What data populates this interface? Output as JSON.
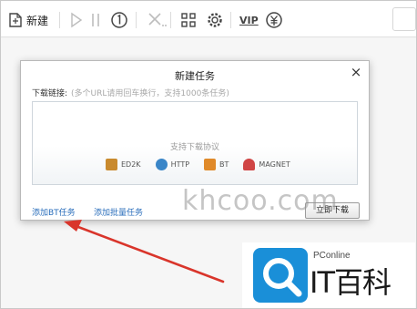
{
  "toolbar": {
    "new_label": "新建",
    "vip_label": "VIP",
    "icons": [
      "new-task-icon",
      "start-icon",
      "pause-icon",
      "info-icon",
      "delete-icon",
      "apps-icon",
      "settings-icon",
      "vip-icon",
      "coin-icon",
      "search-icon"
    ]
  },
  "dialog": {
    "title": "新建任务",
    "close": "×",
    "link_label": "下载链接:",
    "link_hint": "(多个URL请用回车换行，支持1000条任务)",
    "protocols_title": "支持下载协议",
    "protocols": [
      {
        "name": "ED2K",
        "color": "#c98a2e"
      },
      {
        "name": "HTTP",
        "color": "#3a86c8"
      },
      {
        "name": "BT",
        "color": "#e08a2a"
      },
      {
        "name": "MAGNET",
        "color": "#d04545"
      }
    ],
    "add_bt": "添加BT任务",
    "add_batch": "添加批量任务",
    "download_now": "立即下载"
  },
  "watermark": "khcoo.com",
  "logo": {
    "small": "PConline",
    "big": "IT百科",
    "color": "#1a8fd8"
  },
  "annotation_color": "#d9352b"
}
